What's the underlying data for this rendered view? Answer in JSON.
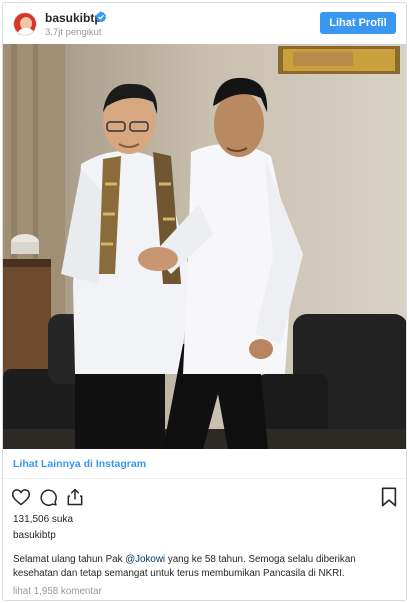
{
  "header": {
    "username": "basukibtp",
    "followers": "3.7jt pengikut",
    "profile_button": "Lihat Profil"
  },
  "post": {
    "more_link": "Lihat Lainnya di Instagram",
    "likes": "131,506 suka",
    "caption_user": "basukibtp",
    "caption_before": "Selamat ulang tahun Pak ",
    "caption_mention": "@Jokowi",
    "caption_after": " yang ke 58 tahun. Semoga selalu diberikan kesehatan dan tetap semangat untuk terus membumikan Pancasila di NKRI.",
    "comments_link": "lihat 1,958 komentar"
  },
  "icons": {
    "like": "heart-icon",
    "comment": "comment-icon",
    "share": "share-icon",
    "save": "bookmark-icon",
    "verified": "verified-badge-icon"
  },
  "colors": {
    "accent": "#3897f0",
    "verified": "#3897f0",
    "mention": "#003569",
    "muted": "#999999"
  }
}
